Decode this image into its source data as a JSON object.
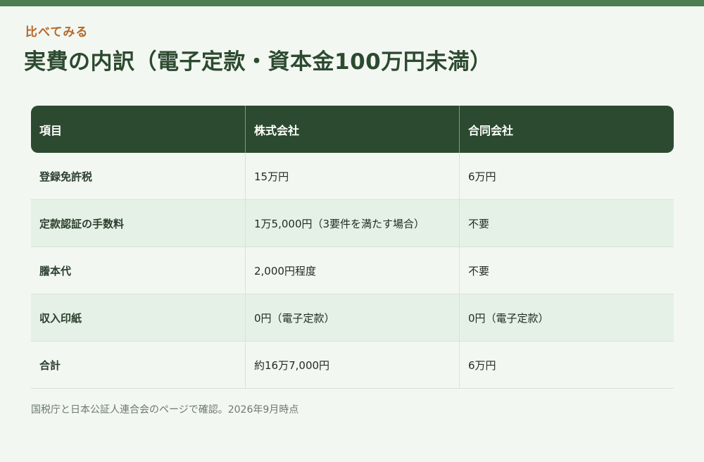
{
  "eyebrow": "比べてみる",
  "title": "実費の内訳（電子定款・資本金100万円未満）",
  "table": {
    "headers": [
      "項目",
      "株式会社",
      "合同会社"
    ],
    "rows": [
      [
        "登録免許税",
        "15万円",
        "6万円"
      ],
      [
        "定款認証の手数料",
        "1万5,000円（3要件を満たす場合）",
        "不要"
      ],
      [
        "謄本代",
        "2,000円程度",
        "不要"
      ],
      [
        "収入印紙",
        "0円（電子定款）",
        "0円（電子定款）"
      ],
      [
        "合計",
        "約16万7,000円",
        "6万円"
      ]
    ]
  },
  "note": "国税庁と日本公証人連合会のページで確認。2026年9月時点",
  "colors": {
    "accent": "#2c4a2f",
    "eyebrow": "#b5692a",
    "background": "#f3f7f2",
    "row_alt": "#e5f1e6"
  }
}
